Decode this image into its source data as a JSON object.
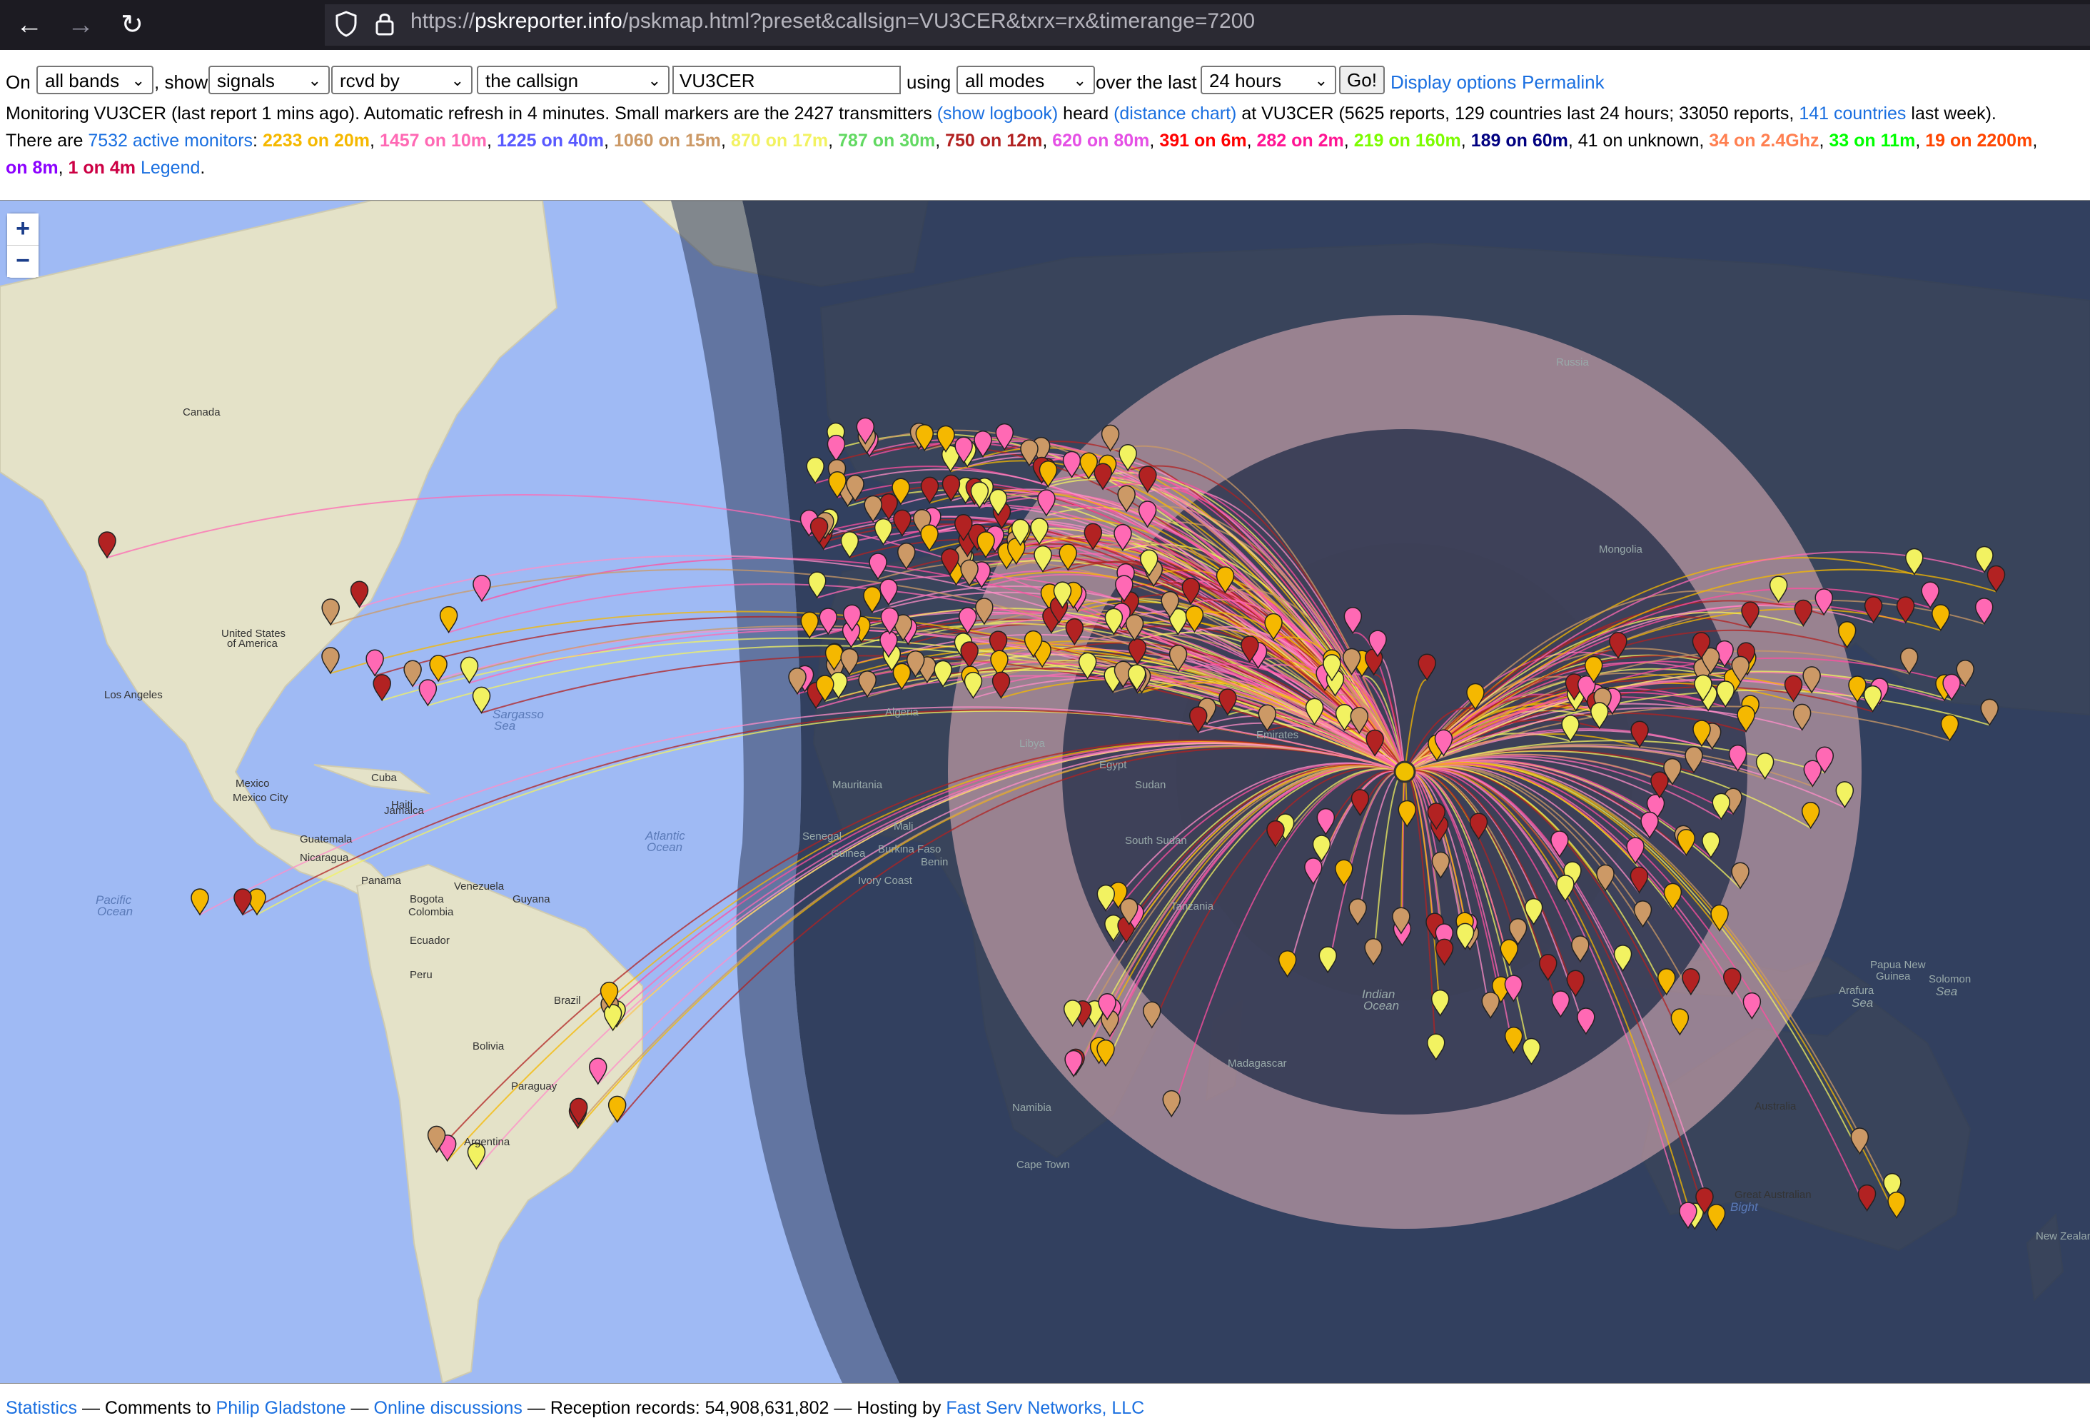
{
  "browser": {
    "back_icon": "back-arrow-icon",
    "forward_icon": "forward-arrow-icon",
    "reload_icon": "reload-icon",
    "url_host_prefix": "https://",
    "url_host": "pskreporter.info",
    "url_path": "/pskmap.html?preset&callsign=VU3CER&txrx=rx&timerange=7200"
  },
  "controls": {
    "on_label": "On",
    "band_select": "all bands",
    "show_label": ", show",
    "show_select": "signals",
    "direction_select": "rcvd by",
    "target_select": "the callsign",
    "callsign_value": "VU3CER",
    "using_label": "using",
    "mode_select": "all modes",
    "over_label": "over the last",
    "time_select": "24 hours",
    "go_button": "Go!",
    "display_options_link": "Display options",
    "permalink_link": "Permalink"
  },
  "status": {
    "line1_a": "Monitoring VU3CER (last report 1 mins ago). Automatic refresh in 4 minutes. Small markers are the 2427 transmitters",
    "show_logbook": "(show logbook)",
    "heard": "heard",
    "distance_chart": "(distance chart)",
    "line1_b": "at VU3CER (5625 reports, 129 countries last 24 hours; 33050 reports,",
    "countries_link": "141 countries",
    "line1_c": "last week).",
    "there_are": "There are",
    "active_monitors": "7532 active monitors",
    "colon": ":",
    "band_counts": [
      {
        "text": "2233 on 20m",
        "color": "#f5b800"
      },
      {
        "text": "1457 on 10m",
        "color": "#ff69b4"
      },
      {
        "text": "1225 on 40m",
        "color": "#5959ff"
      },
      {
        "text": "1060 on 15m",
        "color": "#cc9966"
      },
      {
        "text": "870 on 17m",
        "color": "#f2f261"
      },
      {
        "text": "787 on 30m",
        "color": "#62d962"
      },
      {
        "text": "750 on 12m",
        "color": "#b22222"
      },
      {
        "text": "620 on 80m",
        "color": "#e550e5"
      },
      {
        "text": "391 on 6m",
        "color": "#ff0000"
      },
      {
        "text": "282 on 2m",
        "color": "#ff1493"
      },
      {
        "text": "219 on 160m",
        "color": "#7cfc00"
      },
      {
        "text": "189 on 60m",
        "color": "#000080"
      }
    ],
    "unknown_count": "41 on unknown",
    "band_counts2": [
      {
        "text": "34 on 2.4Ghz",
        "color": "#ff7f50"
      },
      {
        "text": "33 on 11m",
        "color": "#00ff00"
      },
      {
        "text": "19 on 2200m",
        "color": "#ff4500"
      }
    ],
    "band_counts3": [
      {
        "text": "on 8m",
        "color": "#8b00ff"
      },
      {
        "text": "1 on 4m",
        "color": "#cc0044"
      }
    ],
    "legend_link": "Legend"
  },
  "map": {
    "zoom_in": "+",
    "zoom_out": "−",
    "labels": [
      {
        "text": "Canada"
      },
      {
        "text": "United States"
      },
      {
        "text": "of America"
      },
      {
        "text": "Los Angeles"
      },
      {
        "text": "Mexico"
      },
      {
        "text": "Mexico City"
      },
      {
        "text": "Cuba"
      },
      {
        "text": "Haiti"
      },
      {
        "text": "Jamaica"
      },
      {
        "text": "Guatemala"
      },
      {
        "text": "Nicaragua"
      },
      {
        "text": "Panama"
      },
      {
        "text": "Venezuela"
      },
      {
        "text": "Bogota"
      },
      {
        "text": "Colombia"
      },
      {
        "text": "Guyana"
      },
      {
        "text": "Ecuador"
      },
      {
        "text": "Peru"
      },
      {
        "text": "Brazil"
      },
      {
        "text": "Bolivia"
      },
      {
        "text": "Paraguay"
      },
      {
        "text": "Argentina"
      },
      {
        "text": "Sargasso"
      },
      {
        "text": "Sea"
      },
      {
        "text": "Atlantic"
      },
      {
        "text": "Ocean"
      },
      {
        "text": "Pacific"
      },
      {
        "text": "Ocean"
      },
      {
        "text": "Algeria"
      },
      {
        "text": "Mauritania"
      },
      {
        "text": "Senegal"
      },
      {
        "text": "Guinea"
      },
      {
        "text": "Mali"
      },
      {
        "text": "Burkina Faso"
      },
      {
        "text": "Benin"
      },
      {
        "text": "Ivory Coast"
      },
      {
        "text": "Libya"
      },
      {
        "text": "Egypt"
      },
      {
        "text": "Sudan"
      },
      {
        "text": "South Sudan"
      },
      {
        "text": "Tanzania"
      },
      {
        "text": "Namibia"
      },
      {
        "text": "Cape Town"
      },
      {
        "text": "Madagascar"
      },
      {
        "text": "Indian"
      },
      {
        "text": "Ocean"
      },
      {
        "text": "Australia"
      },
      {
        "text": "Great Australian"
      },
      {
        "text": "Bight"
      },
      {
        "text": "Papua New"
      },
      {
        "text": "Guinea"
      },
      {
        "text": "Solomon"
      },
      {
        "text": "Sea"
      },
      {
        "text": "Arafura"
      },
      {
        "text": "Sea"
      },
      {
        "text": "New Zealand"
      },
      {
        "text": "Mongolia"
      },
      {
        "text": "Russia"
      },
      {
        "text": "Emirates"
      }
    ],
    "receiver_callsign": "VU3CER",
    "colors": {
      "ocean": "#9fbaf4",
      "land": "#e4e2c8",
      "night": "#344159",
      "ring": "#d9a7ad"
    }
  },
  "footer": {
    "statistics": "Statistics",
    "sep1": " — Comments to ",
    "author": "Philip Gladstone",
    "sep2": " — ",
    "online_discussions": "Online discussions",
    "records": " — Reception records: 54,908,631,802 — Hosting by ",
    "host": "Fast Serv Networks, LLC"
  }
}
